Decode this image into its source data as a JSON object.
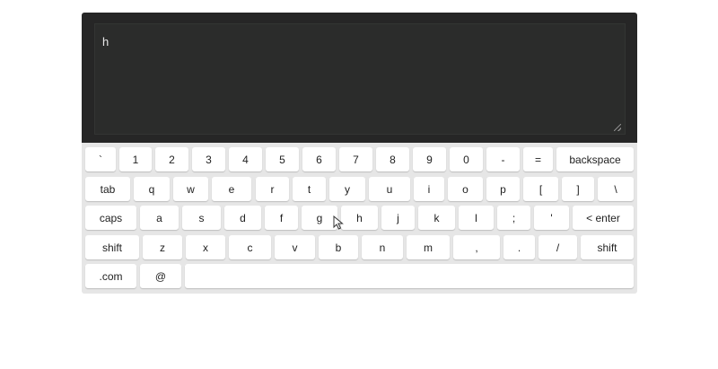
{
  "editor": {
    "text": "h"
  },
  "keyboard": {
    "rows": [
      [
        {
          "name": "key-backtick",
          "label": "`"
        },
        {
          "name": "key-1",
          "label": "1"
        },
        {
          "name": "key-2",
          "label": "2"
        },
        {
          "name": "key-3",
          "label": "3"
        },
        {
          "name": "key-4",
          "label": "4"
        },
        {
          "name": "key-5",
          "label": "5"
        },
        {
          "name": "key-6",
          "label": "6"
        },
        {
          "name": "key-7",
          "label": "7"
        },
        {
          "name": "key-8",
          "label": "8"
        },
        {
          "name": "key-9",
          "label": "9"
        },
        {
          "name": "key-0",
          "label": "0"
        },
        {
          "name": "key-minus",
          "label": "-"
        },
        {
          "name": "key-equals",
          "label": "="
        },
        {
          "name": "key-backspace",
          "label": "backspace"
        }
      ],
      [
        {
          "name": "key-tab",
          "label": "tab"
        },
        {
          "name": "key-q",
          "label": "q"
        },
        {
          "name": "key-w",
          "label": "w"
        },
        {
          "name": "key-e",
          "label": "e"
        },
        {
          "name": "key-r",
          "label": "r"
        },
        {
          "name": "key-t",
          "label": "t"
        },
        {
          "name": "key-y",
          "label": "y"
        },
        {
          "name": "key-u",
          "label": "u"
        },
        {
          "name": "key-i",
          "label": "i"
        },
        {
          "name": "key-o",
          "label": "o"
        },
        {
          "name": "key-p",
          "label": "p"
        },
        {
          "name": "key-left-bracket",
          "label": "["
        },
        {
          "name": "key-right-bracket",
          "label": "]"
        },
        {
          "name": "key-backslash",
          "label": "\\"
        }
      ],
      [
        {
          "name": "key-caps",
          "label": "caps"
        },
        {
          "name": "key-a",
          "label": "a"
        },
        {
          "name": "key-s",
          "label": "s"
        },
        {
          "name": "key-d",
          "label": "d"
        },
        {
          "name": "key-f",
          "label": "f"
        },
        {
          "name": "key-g",
          "label": "g"
        },
        {
          "name": "key-h",
          "label": "h"
        },
        {
          "name": "key-j",
          "label": "j"
        },
        {
          "name": "key-k",
          "label": "k"
        },
        {
          "name": "key-l",
          "label": "l"
        },
        {
          "name": "key-semicolon",
          "label": ";"
        },
        {
          "name": "key-quote",
          "label": "'"
        },
        {
          "name": "key-enter",
          "label": "< enter"
        }
      ],
      [
        {
          "name": "key-shift-left",
          "label": "shift"
        },
        {
          "name": "key-z",
          "label": "z"
        },
        {
          "name": "key-x",
          "label": "x"
        },
        {
          "name": "key-c",
          "label": "c"
        },
        {
          "name": "key-v",
          "label": "v"
        },
        {
          "name": "key-b",
          "label": "b"
        },
        {
          "name": "key-n",
          "label": "n"
        },
        {
          "name": "key-m",
          "label": "m"
        },
        {
          "name": "key-comma",
          "label": ","
        },
        {
          "name": "key-period",
          "label": "."
        },
        {
          "name": "key-slash",
          "label": "/"
        },
        {
          "name": "key-shift-right",
          "label": "shift"
        }
      ],
      [
        {
          "name": "key-dotcom",
          "label": ".com"
        },
        {
          "name": "key-at",
          "label": "@"
        },
        {
          "name": "key-space",
          "label": ""
        }
      ]
    ]
  }
}
